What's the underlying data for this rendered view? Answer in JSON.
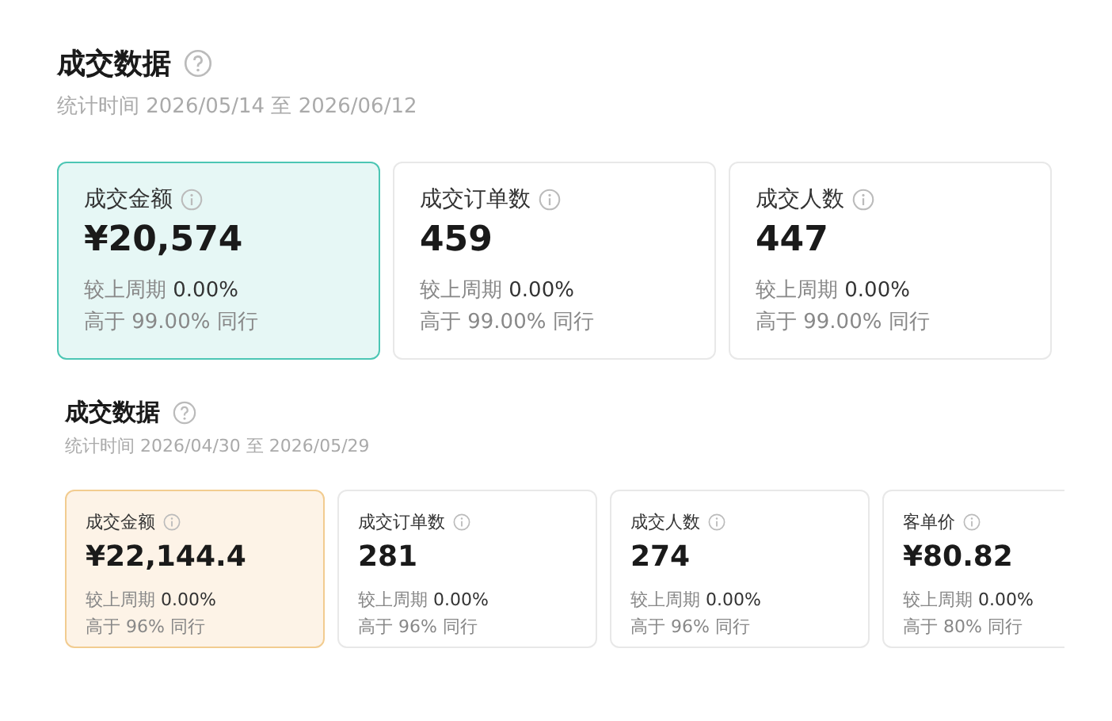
{
  "sections": [
    {
      "kind": "large",
      "title": "成交数据",
      "period": "统计时间 2026/05/14 至 2026/06/12",
      "cards": [
        {
          "label": "成交金额",
          "value": "¥20,574",
          "change_label": "较上周期",
          "change_value": "0.00%",
          "peer": "高于 99.00% 同行",
          "selected": true
        },
        {
          "label": "成交订单数",
          "value": "459",
          "change_label": "较上周期",
          "change_value": "0.00%",
          "peer": "高于 99.00% 同行",
          "selected": false
        },
        {
          "label": "成交人数",
          "value": "447",
          "change_label": "较上周期",
          "change_value": "0.00%",
          "peer": "高于 99.00% 同行",
          "selected": false
        }
      ]
    },
    {
      "kind": "compact",
      "title": "成交数据",
      "period": "统计时间 2026/04/30 至 2026/05/29",
      "cards": [
        {
          "label": "成交金额",
          "value": "¥22,144.4",
          "change_label": "较上周期",
          "change_value": "0.00%",
          "peer": "高于 96% 同行",
          "selected": true
        },
        {
          "label": "成交订单数",
          "value": "281",
          "change_label": "较上周期",
          "change_value": "0.00%",
          "peer": "高于 96% 同行",
          "selected": false
        },
        {
          "label": "成交人数",
          "value": "274",
          "change_label": "较上周期",
          "change_value": "0.00%",
          "peer": "高于 96% 同行",
          "selected": false
        },
        {
          "label": "客单价",
          "value": "¥80.82",
          "change_label": "较上周期",
          "change_value": "0.00%",
          "peer": "高于 80% 同行",
          "selected": false
        }
      ]
    }
  ]
}
